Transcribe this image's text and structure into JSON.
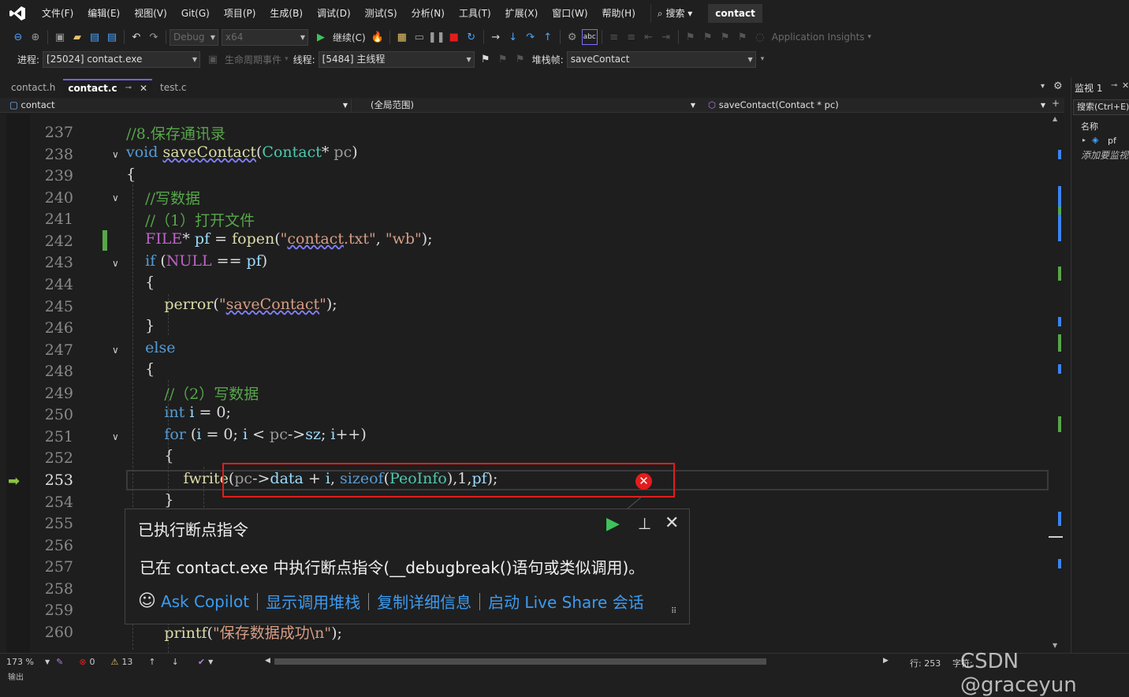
{
  "menu": [
    "文件(F)",
    "编辑(E)",
    "视图(V)",
    "Git(G)",
    "项目(P)",
    "生成(B)",
    "调试(D)",
    "测试(S)",
    "分析(N)",
    "工具(T)",
    "扩展(X)",
    "窗口(W)",
    "帮助(H)"
  ],
  "search_label": "搜索",
  "project_badge": "contact",
  "toolbar": {
    "config": "Debug",
    "platform": "x64",
    "continue_label": "继续(C)",
    "app_insights": "Application Insights"
  },
  "debugbar": {
    "process_label": "进程:",
    "process_value": "[25024] contact.exe",
    "lifecycle_label": "生命周期事件",
    "thread_label": "线程:",
    "thread_value": "[5484] 主线程",
    "stackframe_label": "堆栈帧:",
    "stackframe_value": "saveContact"
  },
  "tabs": [
    "contact.h",
    "contact.c",
    "test.c"
  ],
  "navbar": {
    "project": "contact",
    "scope": "(全局范围)",
    "member": "saveContact(Contact * pc)"
  },
  "editor": {
    "line_numbers": [
      "237",
      "238",
      "239",
      "240",
      "241",
      "242",
      "243",
      "244",
      "245",
      "246",
      "247",
      "248",
      "249",
      "250",
      "251",
      "252",
      "253",
      "254",
      "255",
      "256",
      "257",
      "258",
      "259",
      "260"
    ],
    "current_line": "253"
  },
  "exception": {
    "title": "已执行断点指令",
    "message": "已在 contact.exe 中执行断点指令(__debugbreak()语句或类似调用)。",
    "links": [
      "Ask Copilot",
      "显示调用堆栈",
      "复制详细信息",
      "启动 Live Share 会话"
    ]
  },
  "watch": {
    "title": "监视 1",
    "search": "搜索(Ctrl+E)",
    "column": "名称",
    "item": "pf",
    "add_hint": "添加要监视"
  },
  "status": {
    "zoom": "173 %",
    "errors": "0",
    "warnings": "13",
    "line": "行: 253",
    "char": "字符:"
  },
  "output_label": "输出",
  "watermark": "CSDN @graceyun"
}
